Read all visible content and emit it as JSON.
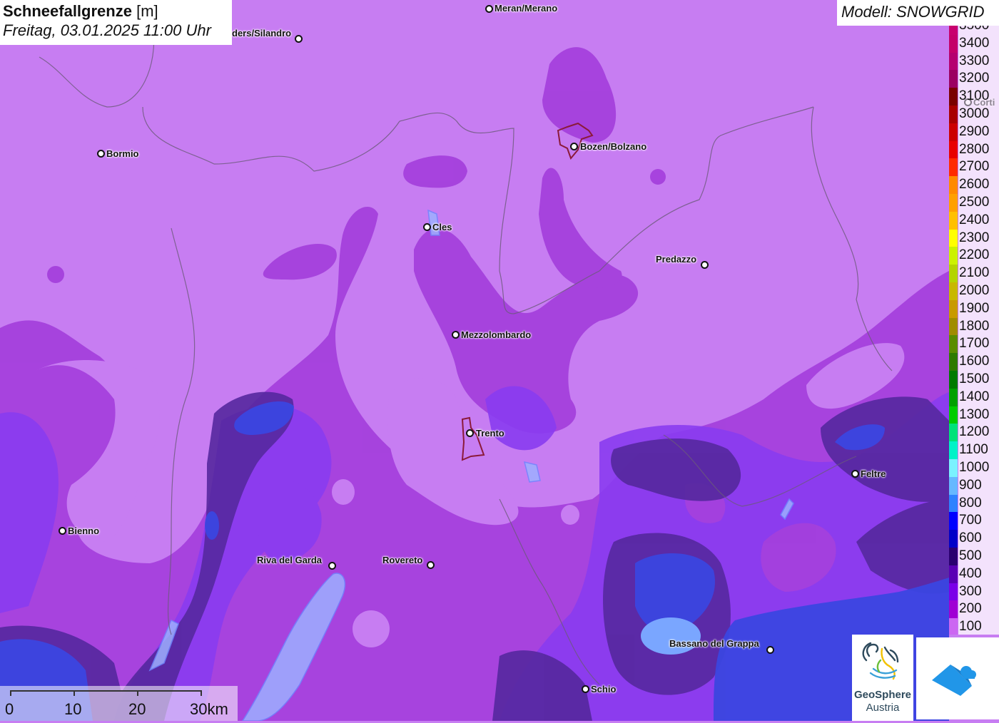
{
  "title": {
    "main": "Schneefallgrenze",
    "unit": "[m]",
    "subtitle": "Freitag, 03.01.2025 11:00 Uhr"
  },
  "model": {
    "label": "Modell: SNOWGRID"
  },
  "legend": [
    {
      "label": "3500",
      "color": "#c8006e"
    },
    {
      "label": "3400",
      "color": "#c4006a"
    },
    {
      "label": "3300",
      "color": "#b50070"
    },
    {
      "label": "3200",
      "color": "#9b0062"
    },
    {
      "label": "3100",
      "color": "#7a0000"
    },
    {
      "label": "3000",
      "color": "#a80000"
    },
    {
      "label": "2900",
      "color": "#cc0000"
    },
    {
      "label": "2800",
      "color": "#e80000"
    },
    {
      "label": "2700",
      "color": "#ff2a00"
    },
    {
      "label": "2600",
      "color": "#ff8a00"
    },
    {
      "label": "2500",
      "color": "#ffa000"
    },
    {
      "label": "2400",
      "color": "#ffc000"
    },
    {
      "label": "2300",
      "color": "#ffff00"
    },
    {
      "label": "2200",
      "color": "#ccf200"
    },
    {
      "label": "2100",
      "color": "#b4d400"
    },
    {
      "label": "2000",
      "color": "#c8b800"
    },
    {
      "label": "1900",
      "color": "#c89a00"
    },
    {
      "label": "1800",
      "color": "#a08c00"
    },
    {
      "label": "1700",
      "color": "#5a8c00"
    },
    {
      "label": "1600",
      "color": "#2e7a00"
    },
    {
      "label": "1500",
      "color": "#007a00"
    },
    {
      "label": "1400",
      "color": "#00a000"
    },
    {
      "label": "1300",
      "color": "#00cc00"
    },
    {
      "label": "1200",
      "color": "#00e27a"
    },
    {
      "label": "1100",
      "color": "#00f2c8"
    },
    {
      "label": "1000",
      "color": "#7af2ff"
    },
    {
      "label": "900",
      "color": "#66b8ff"
    },
    {
      "label": "800",
      "color": "#2e82ff"
    },
    {
      "label": "700",
      "color": "#0000ff"
    },
    {
      "label": "600",
      "color": "#0000c8"
    },
    {
      "label": "500",
      "color": "#2a0070"
    },
    {
      "label": "400",
      "color": "#5a00b4"
    },
    {
      "label": "300",
      "color": "#7a00e8"
    },
    {
      "label": "200",
      "color": "#a000d4"
    },
    {
      "label": "100",
      "color": "#cc66f2"
    }
  ],
  "cities": [
    {
      "name": "Meran/Merano"
    },
    {
      "name": "ders/Silandro"
    },
    {
      "name": "Bormio"
    },
    {
      "name": "Bozen/Bolzano"
    },
    {
      "name": "Cles"
    },
    {
      "name": "Predazzo"
    },
    {
      "name": "Mezzolombardo"
    },
    {
      "name": "Trento"
    },
    {
      "name": "Feltre"
    },
    {
      "name": "Bienno"
    },
    {
      "name": "Riva del Garda"
    },
    {
      "name": "Rovereto"
    },
    {
      "name": "Bassano del Grappa"
    },
    {
      "name": "Schio"
    },
    {
      "name": "Corti"
    }
  ],
  "scale": {
    "labels": [
      "0",
      "10",
      "20",
      "30km"
    ]
  },
  "logo": {
    "line1": "GeoSphere",
    "line2": "Austria"
  }
}
